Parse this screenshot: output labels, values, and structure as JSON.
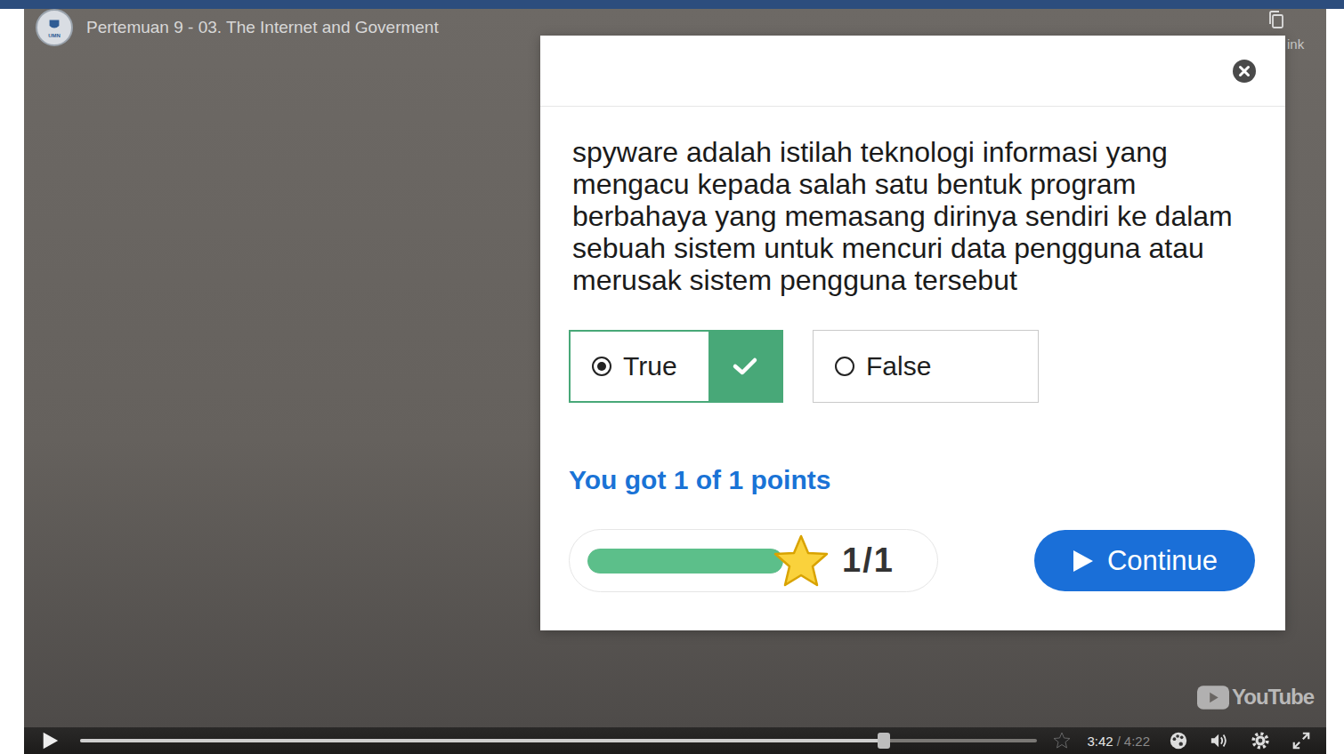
{
  "video": {
    "logo_text": "UMN",
    "title": "Pertemuan 9 - 03. The Internet and Goverment",
    "copy_link_label": "ink",
    "watermark": "YouTube"
  },
  "quiz": {
    "question": "spyware adalah istilah teknologi informasi yang mengacu kepada salah satu bentuk program berbahaya yang memasang dirinya sendiri ke dalam sebuah sistem untuk mencuri data pengguna atau merusak sistem pengguna tersebut",
    "options": [
      {
        "label": "True",
        "selected": true,
        "correct": true
      },
      {
        "label": "False",
        "selected": false,
        "correct": false
      }
    ],
    "score_text": "You got 1 of 1 points",
    "progress": {
      "level": 1,
      "reading": "1/1"
    },
    "continue_button": "Continue"
  },
  "player": {
    "playing": false,
    "level": 0.84,
    "current_time": "3:42",
    "separator": "/",
    "duration": "4:22"
  }
}
